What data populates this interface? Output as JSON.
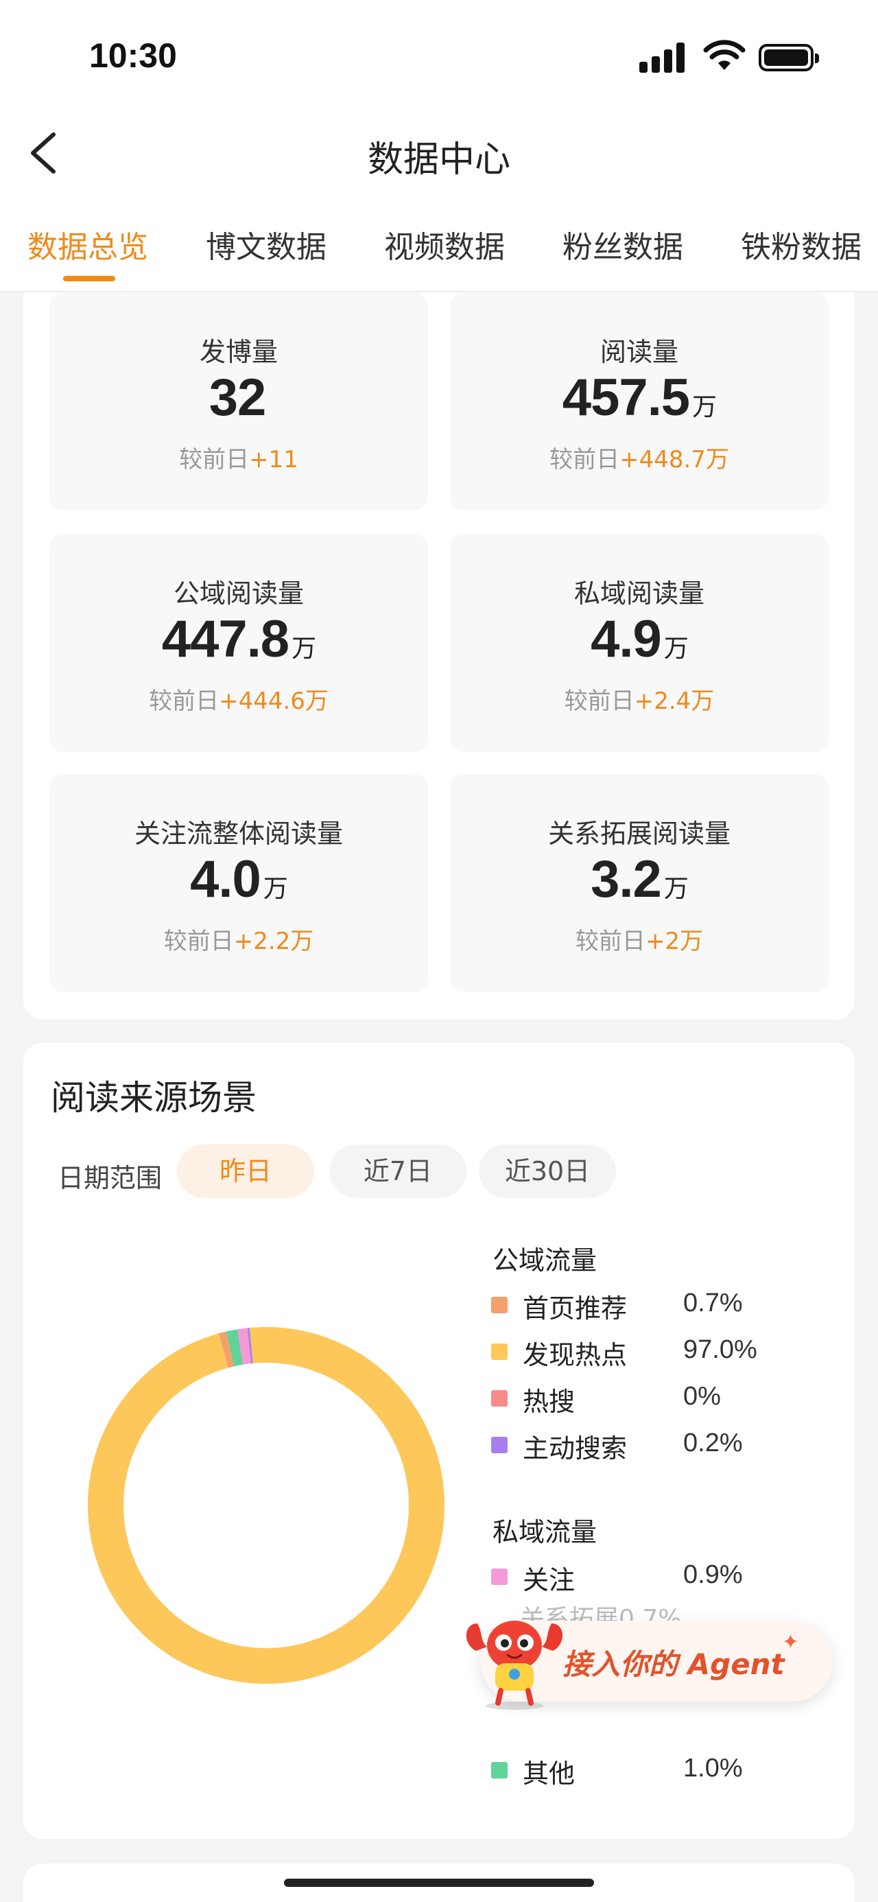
{
  "status_bar": {
    "time": "10:30"
  },
  "nav": {
    "title": "数据中心"
  },
  "tabs": [
    {
      "label": "数据总览",
      "active": true
    },
    {
      "label": "博文数据",
      "active": false
    },
    {
      "label": "视频数据",
      "active": false
    },
    {
      "label": "粉丝数据",
      "active": false
    },
    {
      "label": "铁粉数据",
      "active": false
    }
  ],
  "metrics": [
    {
      "label": "发博量",
      "value": "32",
      "unit": "",
      "delta_prefix": "较前日",
      "delta": "+11"
    },
    {
      "label": "阅读量",
      "value": "457.5",
      "unit": "万",
      "delta_prefix": "较前日",
      "delta": "+448.7万"
    },
    {
      "label": "公域阅读量",
      "value": "447.8",
      "unit": "万",
      "delta_prefix": "较前日",
      "delta": "+444.6万"
    },
    {
      "label": "私域阅读量",
      "value": "4.9",
      "unit": "万",
      "delta_prefix": "较前日",
      "delta": "+2.4万"
    },
    {
      "label": "关注流整体阅读量",
      "value": "4.0",
      "unit": "万",
      "delta_prefix": "较前日",
      "delta": "+2.2万"
    },
    {
      "label": "关系拓展阅读量",
      "value": "3.2",
      "unit": "万",
      "delta_prefix": "较前日",
      "delta": "+2万"
    }
  ],
  "source": {
    "title": "阅读来源场景",
    "date_label": "日期范围",
    "date_options": [
      {
        "label": "昨日",
        "active": true
      },
      {
        "label": "近7日",
        "active": false
      },
      {
        "label": "近30日",
        "active": false
      }
    ],
    "public_title": "公域流量",
    "private_title": "私域流量",
    "faded_text": "关系拓展0.7%"
  },
  "chart_data": {
    "type": "pie",
    "donut": true,
    "groups": [
      {
        "name": "公域流量",
        "items": [
          {
            "name": "首页推荐",
            "value": 0.7,
            "label": "0.7%",
            "color": "#f5a06a"
          },
          {
            "name": "发现热点",
            "value": 97.0,
            "label": "97.0%",
            "color": "#fdc75a"
          },
          {
            "name": "热搜",
            "value": 0,
            "label": "0%",
            "color": "#f78a8a"
          },
          {
            "name": "主动搜索",
            "value": 0.2,
            "label": "0.2%",
            "color": "#a77ef0"
          }
        ]
      },
      {
        "name": "私域流量",
        "items": [
          {
            "name": "关注",
            "value": 0.9,
            "label": "0.9%",
            "color": "#f59ad6"
          },
          {
            "name": "其他",
            "value": 1.0,
            "label": "1.0%",
            "color": "#5fd39a"
          }
        ]
      }
    ]
  },
  "agent_banner": {
    "text": "接入你的 Agent",
    "sparkle": "✦"
  }
}
